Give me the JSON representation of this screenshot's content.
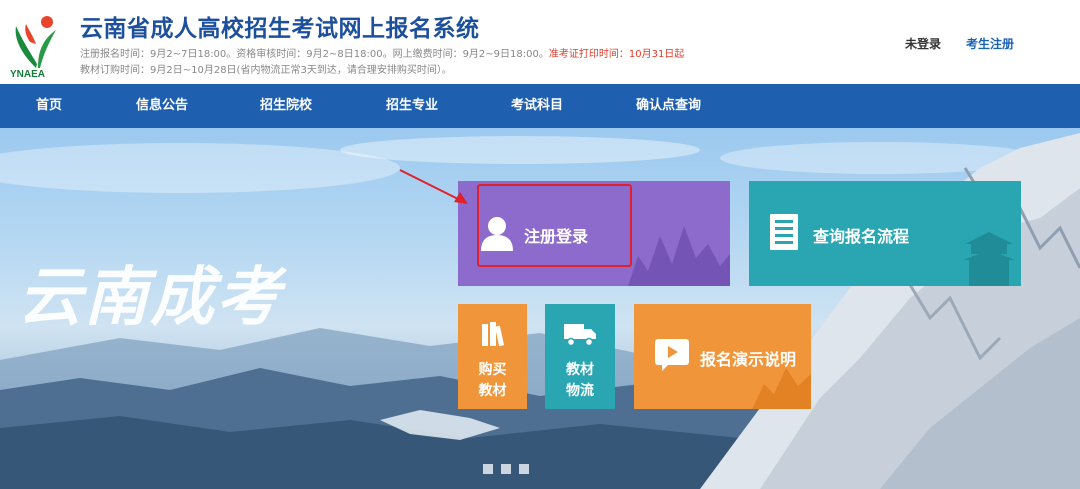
{
  "header": {
    "logo_text": "YNAEA",
    "title": "云南省成人高校招生考试网上报名系统",
    "notice_line1_a": "注册报名时间：9月2~7日18:00。资格审核时间：9月2~8日18:00。网上缴费时间：9月2~9日18:00。",
    "notice_line1_b": "准考证打印时间：10月31日起",
    "notice_line2": "教材订购时间：9月2日~10月28日(省内物流正常3天到达，请合理安排购买时间）。",
    "not_logged_in": "未登录",
    "register_link": "考生注册"
  },
  "nav": {
    "items": [
      "首页",
      "信息公告",
      "招生院校",
      "招生专业",
      "考试科目",
      "确认点查询"
    ]
  },
  "banner": {
    "slogan": "云南成考",
    "tiles": {
      "register_login": "注册登录",
      "query_process": "查询报名流程",
      "buy_books_l1": "购买",
      "buy_books_l2": "教材",
      "logistics_l1": "教材",
      "logistics_l2": "物流",
      "demo": "报名演示说明"
    }
  },
  "colors": {
    "brand_blue": "#1c4f9c",
    "nav_blue": "#1f5fb0",
    "tile_purple": "#8d6bcc",
    "tile_teal": "#2aa6b3",
    "tile_orange": "#f0953a",
    "alert_red": "#e23b2a"
  }
}
